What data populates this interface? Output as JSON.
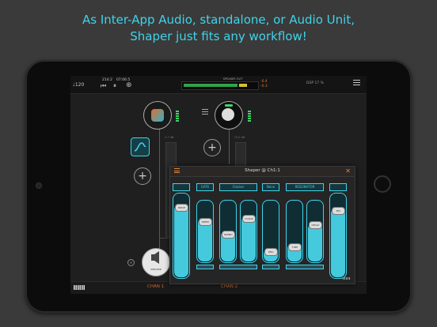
{
  "caption": {
    "line1": "As Inter-App Audio, standalone, or Audio Unit,",
    "line2": "Shaper just fits any workflow!"
  },
  "colors": {
    "accent": "#3fd3ea",
    "orange": "#e07a2f",
    "background": "#3a3a3a"
  },
  "topbar": {
    "tempo": "♩120",
    "position": "214:2",
    "time": "07:06.5",
    "speaker_out": "SPEAKER OUT",
    "meter_left": "-0.4",
    "meter_right": "-0.3",
    "cpu": "DSP 17 %"
  },
  "graph": {
    "chan1": "CHAN 1",
    "chan2": "CHAN 2",
    "speaker_label": "SPEAKER",
    "db1": "-3.7 dB",
    "db2": "+0.0 dB"
  },
  "plugin": {
    "title": "Shaper @ Ch1:1",
    "columns": [
      {
        "header": "",
        "knob": "DRIVE",
        "level": 0.85
      },
      {
        "header": "GATE",
        "knob": "SPEED",
        "level": 0.7
      },
      {
        "header": "Clacker",
        "knob": "BLEND",
        "level": 0.5
      },
      {
        "header": "",
        "knob": "COLOR",
        "level": 0.75
      },
      {
        "header": "None",
        "knob": "ENV.",
        "level": 0.2
      },
      {
        "header": "RESONATOR",
        "knob": "TIME",
        "level": 0.3
      },
      {
        "header": "",
        "knob": "DECAY",
        "level": 0.62
      },
      {
        "header": "",
        "knob": "MIX",
        "level": 0.82
      }
    ]
  }
}
